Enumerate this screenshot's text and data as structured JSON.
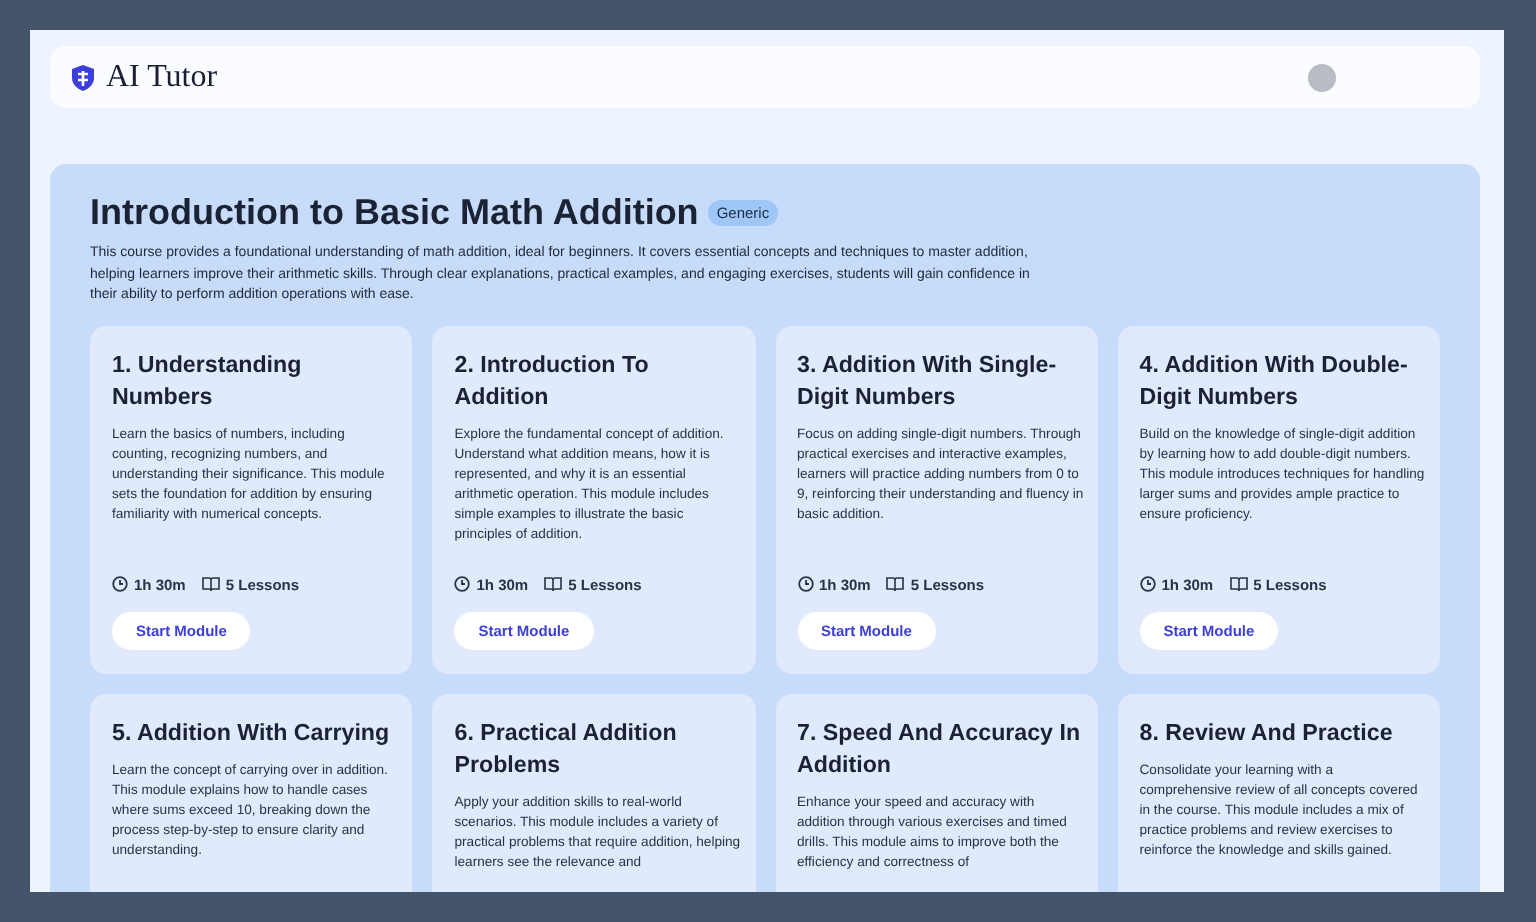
{
  "header": {
    "brand": "AI Tutor"
  },
  "course": {
    "title": "Introduction to Basic Math Addition",
    "tag": "Generic",
    "description": "This course provides a foundational understanding of math addition, ideal for beginners. It covers essential concepts and techniques to master addition, helping learners improve their arithmetic skills. Through clear explanations, practical examples, and engaging exercises, students will gain confidence in their ability to perform addition operations with ease."
  },
  "modules": [
    {
      "title": "1. Understanding Numbers",
      "description": "Learn the basics of numbers, including counting, recognizing numbers, and understanding their significance. This module sets the foundation for addition by ensuring familiarity with numerical concepts.",
      "duration": "1h 30m",
      "lessons": "5 Lessons",
      "button": "Start Module"
    },
    {
      "title": "2. Introduction To Addition",
      "description": "Explore the fundamental concept of addition. Understand what addition means, how it is represented, and why it is an essential arithmetic operation. This module includes simple examples to illustrate the basic principles of addition.",
      "duration": "1h 30m",
      "lessons": "5 Lessons",
      "button": "Start Module"
    },
    {
      "title": "3. Addition With Single-Digit Numbers",
      "description": "Focus on adding single-digit numbers. Through practical exercises and interactive examples, learners will practice adding numbers from 0 to 9, reinforcing their understanding and fluency in basic addition.",
      "duration": "1h 30m",
      "lessons": "5 Lessons",
      "button": "Start Module"
    },
    {
      "title": "4. Addition With Double-Digit Numbers",
      "description": "Build on the knowledge of single-digit addition by learning how to add double-digit numbers. This module introduces techniques for handling larger sums and provides ample practice to ensure proficiency.",
      "duration": "1h 30m",
      "lessons": "5 Lessons",
      "button": "Start Module"
    },
    {
      "title": "5. Addition With Carrying",
      "description": "Learn the concept of carrying over in addition. This module explains how to handle cases where sums exceed 10, breaking down the process step-by-step to ensure clarity and understanding."
    },
    {
      "title": "6. Practical Addition Problems",
      "description": "Apply your addition skills to real-world scenarios. This module includes a variety of practical problems that require addition, helping learners see the relevance and"
    },
    {
      "title": "7. Speed And Accuracy In Addition",
      "description": "Enhance your speed and accuracy with addition through various exercises and timed drills. This module aims to improve both the efficiency and correctness of"
    },
    {
      "title": "8. Review And Practice",
      "description": "Consolidate your learning with a comprehensive review of all concepts covered in the course. This module includes a mix of practice problems and review exercises to reinforce the knowledge and skills gained."
    }
  ]
}
